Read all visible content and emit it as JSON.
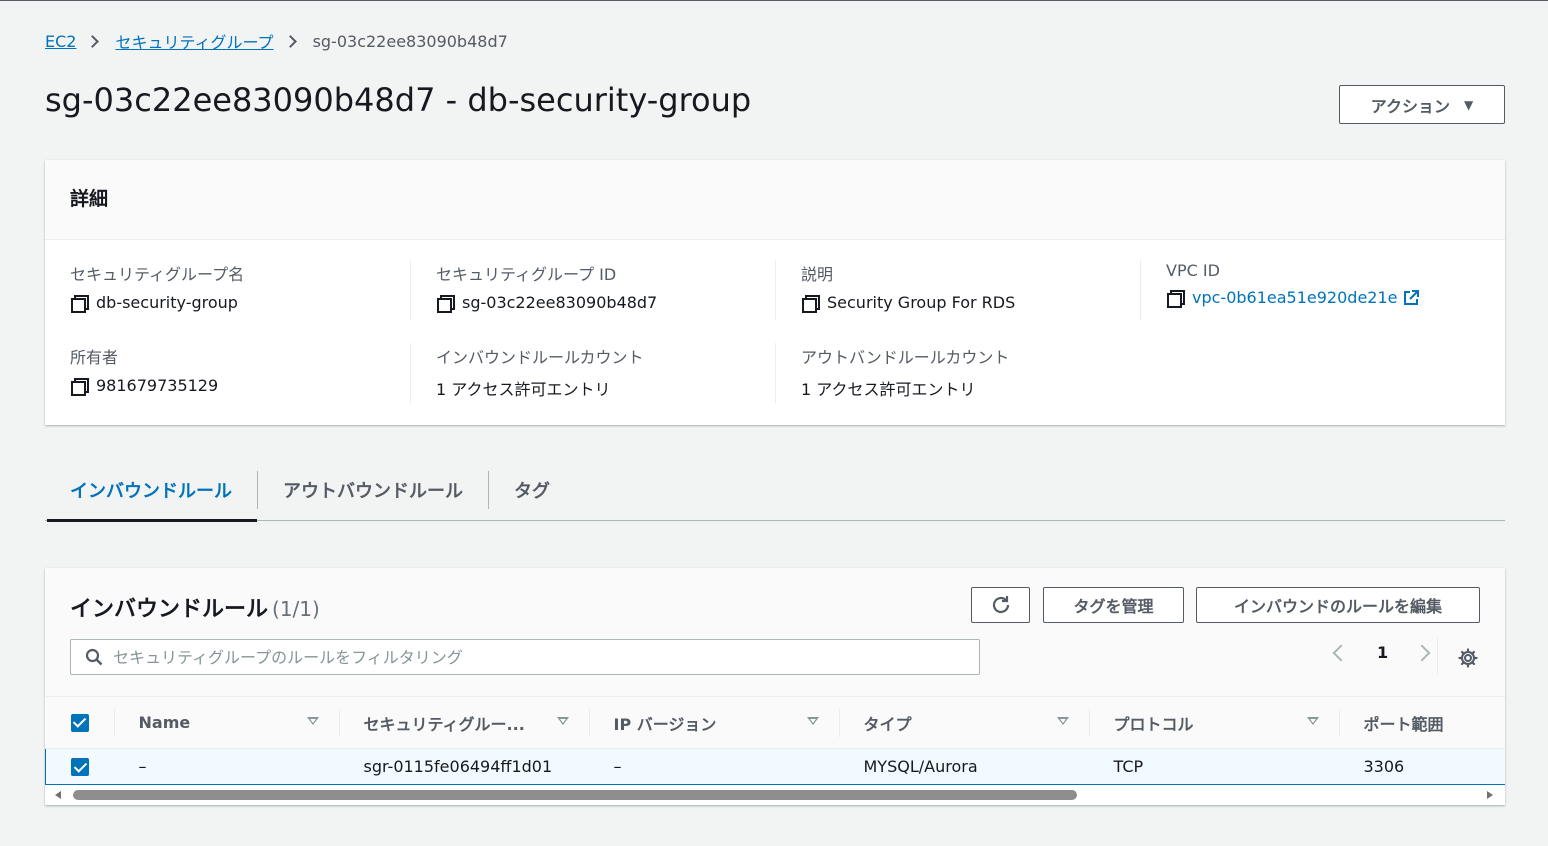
{
  "breadcrumb": {
    "items": [
      "EC2",
      "セキュリティグループ"
    ],
    "current": "sg-03c22ee83090b48d7"
  },
  "page": {
    "title": "sg-03c22ee83090b48d7 - db-security-group",
    "actions_label": "アクション"
  },
  "details": {
    "header": "詳細",
    "fields": [
      {
        "label": "セキュリティグループ名",
        "value": "db-security-group"
      },
      {
        "label": "セキュリティグループ ID",
        "value": "sg-03c22ee83090b48d7"
      },
      {
        "label": "説明",
        "value": "Security Group For RDS"
      },
      {
        "label": "VPC ID",
        "value": "vpc-0b61ea51e920de21e"
      },
      {
        "label": "所有者",
        "value": "981679735129"
      },
      {
        "label": "インバウンドルールカウント",
        "value": "1 アクセス許可エントリ"
      },
      {
        "label": "アウトバンドルールカウント",
        "value": "1 アクセス許可エントリ"
      }
    ]
  },
  "tabs": [
    "インバウンドルール",
    "アウトバウンドルール",
    "タグ"
  ],
  "rules": {
    "title": "インバウンドルール",
    "count": "(1/1)",
    "manage_tags_label": "タグを管理",
    "edit_label": "インバウンドのルールを編集",
    "search_placeholder": "セキュリティグループのルールをフィルタリング",
    "page": "1",
    "columns": [
      "Name",
      "セキュリティグルー...",
      "IP バージョン",
      "タイプ",
      "プロトコル",
      "ポート範囲"
    ],
    "rows": [
      {
        "name": "–",
        "sgr_id": "sgr-0115fe06494ff1d01",
        "ip_version": "–",
        "type": "MYSQL/Aurora",
        "protocol": "TCP",
        "port": "3306"
      }
    ]
  },
  "colors": {
    "accent": "#0073bb",
    "text": "#16191f",
    "muted": "#545b64",
    "background": "#f2f3f3"
  }
}
